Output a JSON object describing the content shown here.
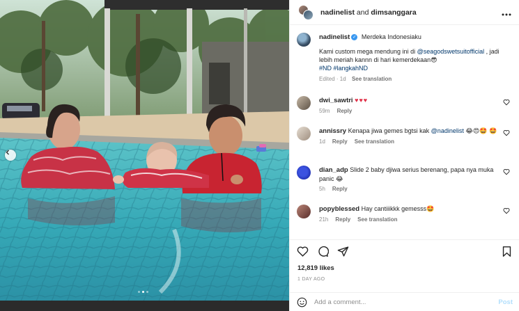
{
  "header": {
    "user1": "nadinelist",
    "connector": " and ",
    "user2": "dimsanggara",
    "more_icon": "more-horizontal-icon"
  },
  "caption": {
    "username": "nadinelist",
    "text": "Merdeka Indonesiaku",
    "body_prefix": "Kami custom mega mendung ini di ",
    "mention": "@seagodswetsuitofficial",
    "body_suffix": " , jadi lebih meriah kannn di hari kemerdekaan😎",
    "hashtags": "#ND #langkahND",
    "edited": "Edited",
    "time": "· 1d",
    "see_translation": "See translation"
  },
  "comments": [
    {
      "username": "dwi_sawtri",
      "text": "♥♥♥",
      "time": "59m",
      "reply": "Reply",
      "see_translation": ""
    },
    {
      "username": "annissry",
      "text": "Kenapa jiwa gemes bgtsi kak ",
      "mention": "@nadinelist",
      "emoji": "😂😍🤩 🤩",
      "time": "1d",
      "reply": "Reply",
      "see_translation": "See translation"
    },
    {
      "username": "dian_adp",
      "text": "Slide 2 baby djiwa serius berenang, papa nya muka panic 😂",
      "time": "5h",
      "reply": "Reply",
      "see_translation": ""
    },
    {
      "username": "popyblessed",
      "text": "Hay cantiiikkk gemesss🤩",
      "time": "21h",
      "reply": "Reply",
      "see_translation": "See translation"
    }
  ],
  "actions": {
    "likes": "12,819 likes",
    "time_ago": "1 DAY AGO"
  },
  "add_comment": {
    "placeholder": "Add a comment...",
    "post": "Post"
  },
  "carousel": {
    "dots": 3,
    "active_dot": 1
  },
  "colors": {
    "link": "#00376b",
    "verified": "#3897f0",
    "post_disabled": "#b2dffc",
    "secondary_text": "#8e8e8e"
  }
}
